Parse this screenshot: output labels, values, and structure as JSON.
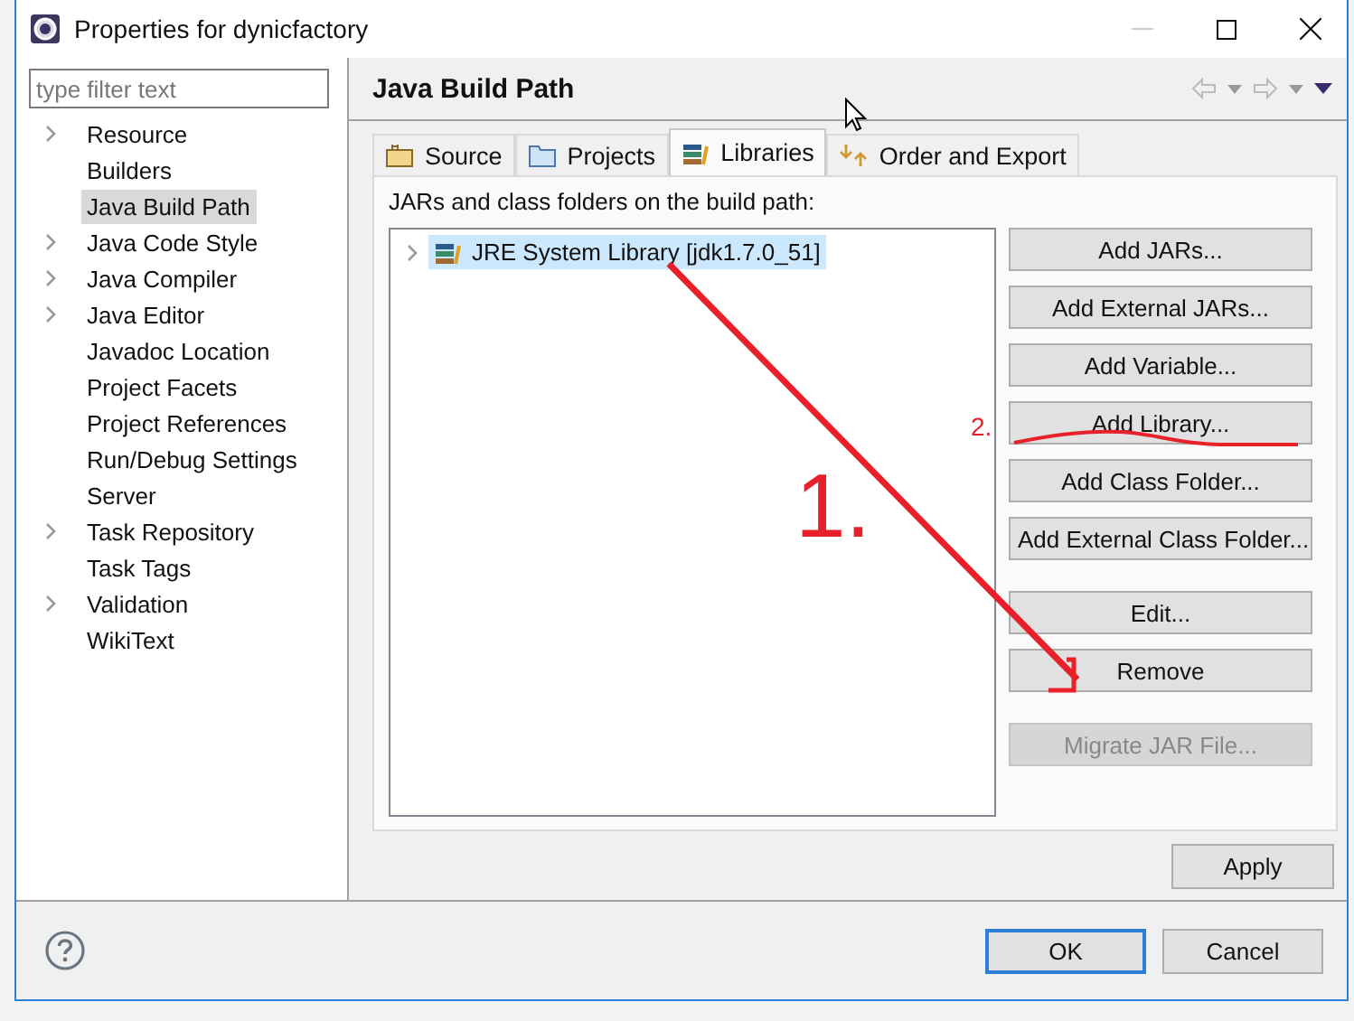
{
  "window": {
    "title": "Properties for dynicfactory"
  },
  "filter": {
    "placeholder": "type filter text"
  },
  "nav": [
    {
      "label": "Resource",
      "expandable": true,
      "selected": false
    },
    {
      "label": "Builders",
      "expandable": false,
      "selected": false
    },
    {
      "label": "Java Build Path",
      "expandable": false,
      "selected": true
    },
    {
      "label": "Java Code Style",
      "expandable": true,
      "selected": false
    },
    {
      "label": "Java Compiler",
      "expandable": true,
      "selected": false
    },
    {
      "label": "Java Editor",
      "expandable": true,
      "selected": false
    },
    {
      "label": "Javadoc Location",
      "expandable": false,
      "selected": false
    },
    {
      "label": "Project Facets",
      "expandable": false,
      "selected": false
    },
    {
      "label": "Project References",
      "expandable": false,
      "selected": false
    },
    {
      "label": "Run/Debug Settings",
      "expandable": false,
      "selected": false
    },
    {
      "label": "Server",
      "expandable": false,
      "selected": false
    },
    {
      "label": "Task Repository",
      "expandable": true,
      "selected": false
    },
    {
      "label": "Task Tags",
      "expandable": false,
      "selected": false
    },
    {
      "label": "Validation",
      "expandable": true,
      "selected": false
    },
    {
      "label": "WikiText",
      "expandable": false,
      "selected": false
    }
  ],
  "page": {
    "title": "Java Build Path"
  },
  "tabs": [
    {
      "label": "Source",
      "selected": false
    },
    {
      "label": "Projects",
      "selected": false
    },
    {
      "label": "Libraries",
      "selected": true
    },
    {
      "label": "Order and Export",
      "selected": false
    }
  ],
  "build_path": {
    "label": "JARs and class folders on the build path:",
    "entries": [
      {
        "label": "JRE System Library [jdk1.7.0_51]",
        "selected": true
      }
    ]
  },
  "button_groups": [
    [
      {
        "label": "Add JARs...",
        "disabled": false
      },
      {
        "label": "Add External JARs...",
        "disabled": false
      },
      {
        "label": "Add Variable...",
        "disabled": false
      },
      {
        "label": "Add Library...",
        "disabled": false
      },
      {
        "label": "Add Class Folder...",
        "disabled": false
      },
      {
        "label": "Add External Class Folder...",
        "disabled": false
      }
    ],
    [
      {
        "label": "Edit...",
        "disabled": false
      },
      {
        "label": "Remove",
        "disabled": false
      }
    ],
    [
      {
        "label": "Migrate JAR File...",
        "disabled": true
      }
    ]
  ],
  "apply_button": "Apply",
  "footer_buttons": [
    {
      "label": "OK",
      "default": true
    },
    {
      "label": "Cancel",
      "default": false
    }
  ],
  "annotations": [
    {
      "text": "1."
    },
    {
      "text": "2."
    }
  ]
}
